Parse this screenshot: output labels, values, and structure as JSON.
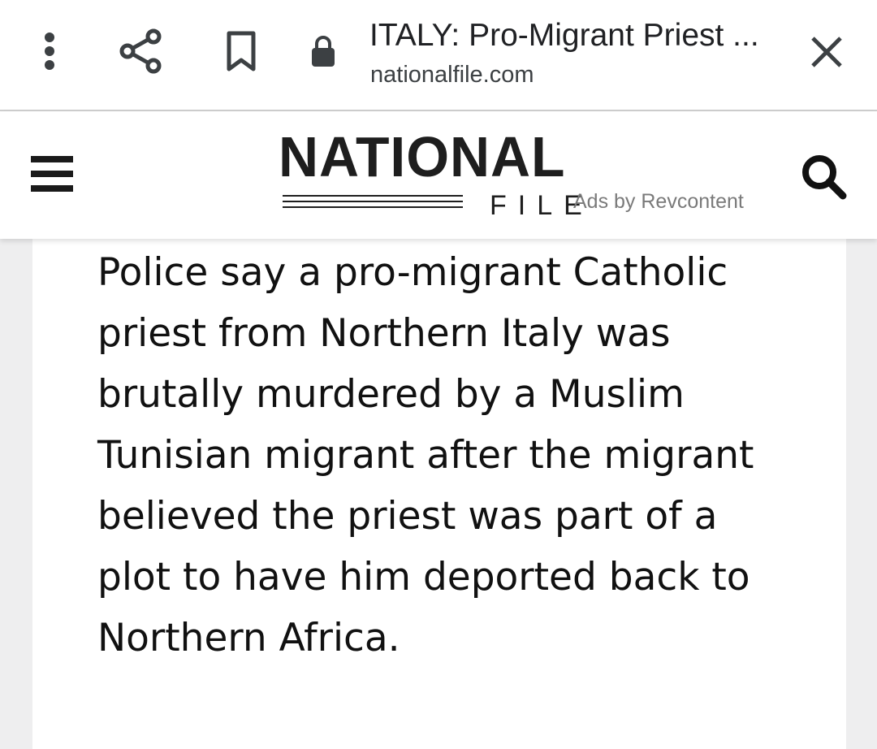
{
  "browser_bar": {
    "menu_icon": "more-vert-icon",
    "share_icon": "share-icon",
    "bookmark_icon": "bookmark-icon",
    "lock_icon": "lock-icon",
    "close_icon": "close-icon",
    "page_title": "ITALY: Pro-Migrant Priest ...",
    "page_url": "nationalfile.com"
  },
  "site_header": {
    "menu_icon": "hamburger-menu-icon",
    "logo_main": "NATIONAL",
    "logo_sub": "FILE",
    "ads_label": "Ads by Revcontent",
    "search_icon": "search-icon"
  },
  "article": {
    "paragraph": "Police say a pro-migrant Catholic priest from Northern Italy was brutally murdered by a Muslim Tunisian migrant after the migrant believed the priest was part of a plot to have him deported back to Northern Africa."
  }
}
